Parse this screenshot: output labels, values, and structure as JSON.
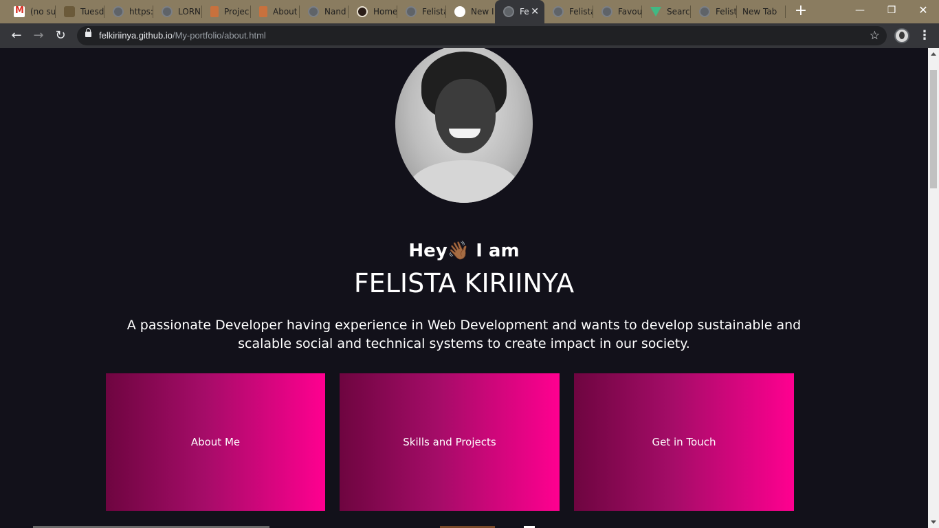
{
  "browser": {
    "tabs": [
      {
        "title": "(no su",
        "icon": "gmail-icon"
      },
      {
        "title": "Tuesd",
        "icon": "tree-icon"
      },
      {
        "title": "https:",
        "icon": "globe-icon"
      },
      {
        "title": "LORN",
        "icon": "globe-icon"
      },
      {
        "title": "Projec",
        "icon": "doc-icon"
      },
      {
        "title": "About",
        "icon": "doc-icon"
      },
      {
        "title": "Nand",
        "icon": "globe-icon"
      },
      {
        "title": "Home",
        "icon": "photo-icon"
      },
      {
        "title": "Felista",
        "icon": "globe-icon"
      },
      {
        "title": "New I",
        "icon": "github-icon"
      },
      {
        "title": "Fe",
        "icon": "globe-icon",
        "active": true
      },
      {
        "title": "Felista",
        "icon": "globe-icon"
      },
      {
        "title": "Favou",
        "icon": "globe-icon"
      },
      {
        "title": "Searc",
        "icon": "vue-icon"
      },
      {
        "title": "Felista",
        "icon": "globe-icon"
      },
      {
        "title": "New Tab",
        "icon": ""
      }
    ],
    "new_tab_symbol": "+",
    "window_controls": {
      "minimize": "—",
      "restore": "❐",
      "close": "✕"
    },
    "toolbar": {
      "back": "←",
      "forward": "→",
      "reload": "↻",
      "url_host": "felkiriinya.github.io",
      "url_path": "/My-portfolio/about.html",
      "bookmark_star": "☆",
      "menu": "⋮"
    }
  },
  "page": {
    "greeting": "Hey",
    "greeting_emoji": "👋🏾",
    "greeting_suffix": " I am",
    "name": "FELISTA KIRIINYA",
    "tagline": "A passionate Developer having experience in Web Development and wants to develop sustainable and scalable social and technical systems to create impact in our society.",
    "cards": [
      {
        "label": "About Me"
      },
      {
        "label": "Skills and Projects"
      },
      {
        "label": "Get in Touch"
      }
    ]
  },
  "colors": {
    "page_bg": "#12111a",
    "card_gradient_start": "#6e0540",
    "card_gradient_end": "#ff0090",
    "tabstrip_bg": "#8a7c60",
    "toolbar_bg": "#35363a"
  }
}
